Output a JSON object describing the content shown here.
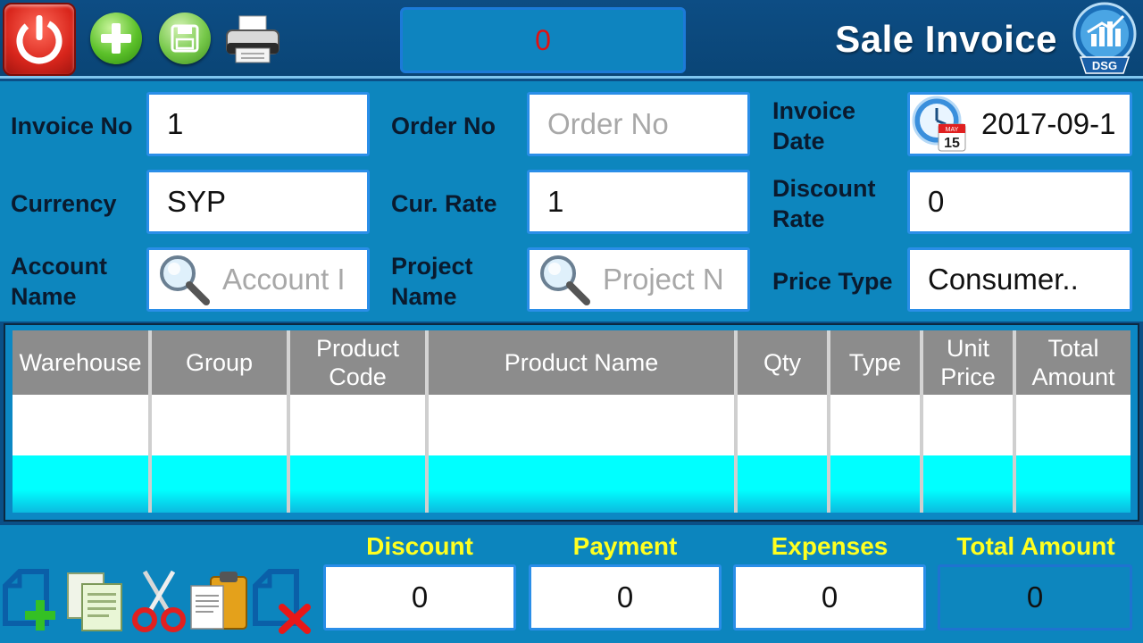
{
  "toolbar": {
    "power_icon": "power-icon",
    "add_icon": "plus-icon",
    "save_icon": "floppy-disk-icon",
    "print_icon": "printer-icon",
    "counter_value": "0",
    "counter_color": "#e01010"
  },
  "header": {
    "title": "Sale Invoice",
    "logo_text": "DSG"
  },
  "form": {
    "invoice_no_label": "Invoice No",
    "invoice_no_value": "1",
    "order_no_label": "Order No",
    "order_no_placeholder": "Order No",
    "invoice_date_label_1": "Invoice",
    "invoice_date_label_2": "Date",
    "invoice_date_value": "2017-09-1",
    "calendar_month": "MAY",
    "calendar_day": "15",
    "currency_label": "Currency",
    "currency_value": "SYP",
    "cur_rate_label": "Cur. Rate",
    "cur_rate_value": "1",
    "discount_rate_label_1": "Discount",
    "discount_rate_label_2": "Rate",
    "discount_rate_value": "0",
    "account_name_label_1": "Account",
    "account_name_label_2": "Name",
    "account_name_placeholder": "Account I",
    "project_name_label_1": "Project",
    "project_name_label_2": "Name",
    "project_name_placeholder": "Project N",
    "price_type_label": "Price Type",
    "price_type_value": "Consumer.."
  },
  "grid": {
    "columns": [
      {
        "label": "Warehouse"
      },
      {
        "label": "Group"
      },
      {
        "label": "Product Code"
      },
      {
        "label": "Product Name"
      },
      {
        "label": "Qty"
      },
      {
        "label": "Type"
      },
      {
        "label": "Unit Price"
      },
      {
        "label": "Total Amount"
      }
    ]
  },
  "footer": {
    "tools": [
      "new-document-icon",
      "copy-icon",
      "cut-icon",
      "paste-icon",
      "delete-document-icon"
    ],
    "discount_label": "Discount",
    "discount_value": "0",
    "payment_label": "Payment",
    "payment_value": "0",
    "expenses_label": "Expenses",
    "expenses_value": "0",
    "total_amount_label": "Total Amount",
    "total_amount_value": "0"
  }
}
